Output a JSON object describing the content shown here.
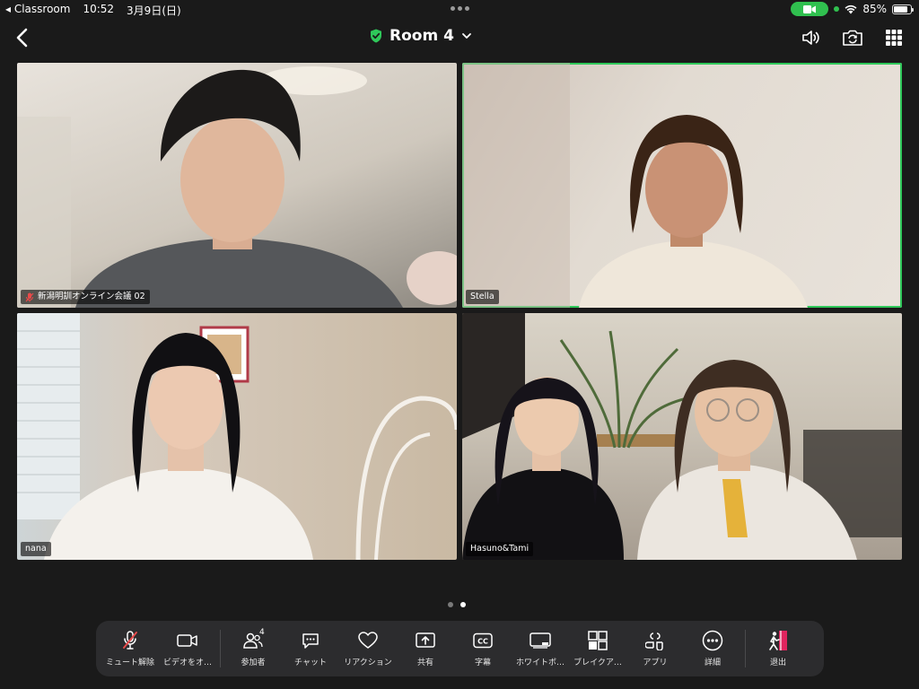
{
  "status_bar": {
    "back_app": "◂ Classroom",
    "time": "10:52",
    "date": "3月9日(日)",
    "battery": "85%",
    "battery_level": 0.85
  },
  "header": {
    "room_name": "Room 4",
    "icons": [
      "back-icon",
      "shield-check-icon",
      "chevron-down-icon",
      "speaker-icon",
      "camera-switch-icon",
      "grid-icon"
    ]
  },
  "participants": [
    {
      "name": "新潟明訓オンライン会議 02",
      "muted": true,
      "active": false
    },
    {
      "name": "Stella",
      "muted": false,
      "active": true
    },
    {
      "name": "nana",
      "muted": false,
      "active": false
    },
    {
      "name": "Hasuno&Tami",
      "muted": false,
      "active": false
    }
  ],
  "pager": {
    "pages": 2,
    "current": 2
  },
  "toolbar": {
    "mute": "ミュート解除",
    "video": "ビデオをオ…",
    "participants": "参加者",
    "participants_count": "4",
    "chat": "チャット",
    "reactions": "リアクション",
    "share": "共有",
    "captions": "字幕",
    "whiteboard": "ホワイトボ…",
    "breakout": "ブレイクア…",
    "apps": "アプリ",
    "more": "詳細",
    "leave": "退出"
  },
  "colors": {
    "accent_green": "#2fc85a",
    "leave_red": "#e0245e",
    "muted_red": "#e84a4a",
    "toolbar_bg": "#2c2c2e"
  }
}
